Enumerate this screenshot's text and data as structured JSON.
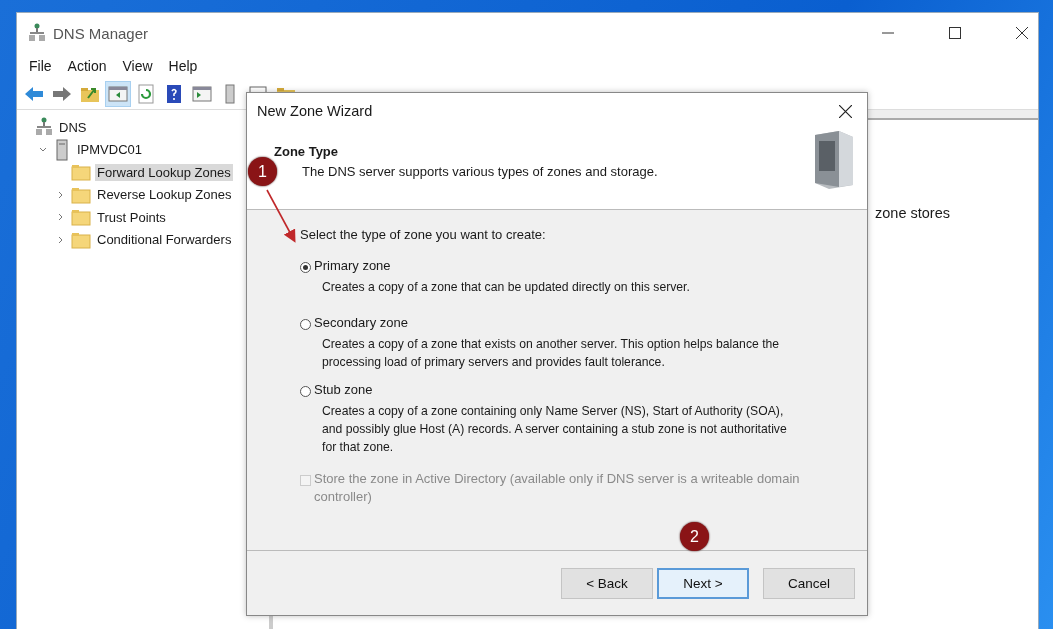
{
  "window": {
    "title": "DNS Manager"
  },
  "menu": [
    "File",
    "Action",
    "View",
    "Help"
  ],
  "toolbar": [
    {
      "kind": "back",
      "pressed": false
    },
    {
      "kind": "forward",
      "pressed": false
    },
    {
      "kind": "up",
      "pressed": false
    },
    {
      "kind": "tree",
      "pressed": true
    },
    {
      "kind": "refresh",
      "pressed": false
    },
    {
      "kind": "help",
      "pressed": false
    },
    {
      "kind": "pane",
      "pressed": false
    },
    {
      "kind": "server",
      "pressed": false
    },
    {
      "kind": "window",
      "pressed": false
    },
    {
      "kind": "folder",
      "pressed": false
    }
  ],
  "tree": [
    {
      "label": "DNS",
      "kind": "root",
      "selected": false,
      "children": [
        {
          "label": "IPMVDC01",
          "kind": "server",
          "selected": false,
          "expanded": true,
          "children": [
            {
              "label": "Forward Lookup Zones",
              "kind": "folder",
              "selected": true
            },
            {
              "label": "Reverse Lookup Zones",
              "kind": "folder",
              "selected": false,
              "expanded": false
            },
            {
              "label": "Trust Points",
              "kind": "folder",
              "selected": false,
              "expanded": false
            },
            {
              "label": "Conditional Forwarders",
              "kind": "folder",
              "selected": false,
              "expanded": false
            }
          ]
        }
      ]
    }
  ],
  "content_text": "zone stores",
  "dialog": {
    "title": "New Zone Wizard",
    "heading": "Zone Type",
    "subtitle": "The DNS server supports various types of zones and storage.",
    "prompt": "Select the type of zone you want to create:",
    "options": [
      {
        "kind": "radio",
        "label": "Primary zone",
        "description": "Creates a copy of a zone that can be updated directly on this server.",
        "selected": true
      },
      {
        "kind": "radio",
        "label": "Secondary zone",
        "description": "Creates a copy of a zone that exists on another server. This option helps balance the processing load of primary servers and provides fault tolerance.",
        "selected": false
      },
      {
        "kind": "radio",
        "label": "Stub zone",
        "description": "Creates a copy of a zone containing only Name Server (NS), Start of Authority (SOA), and possibly glue Host (A) records. A server containing a stub zone is not authoritative for that zone.",
        "selected": false
      },
      {
        "kind": "checkbox",
        "label": "Store the zone in Active Directory (available only if DNS server is a writeable domain controller)",
        "checked": false,
        "disabled": true
      }
    ],
    "buttons": [
      {
        "label": "< Back",
        "default": false
      },
      {
        "label": "Next >",
        "default": true
      },
      {
        "label": "Cancel",
        "default": false
      }
    ]
  },
  "callouts": [
    "1",
    "2"
  ]
}
